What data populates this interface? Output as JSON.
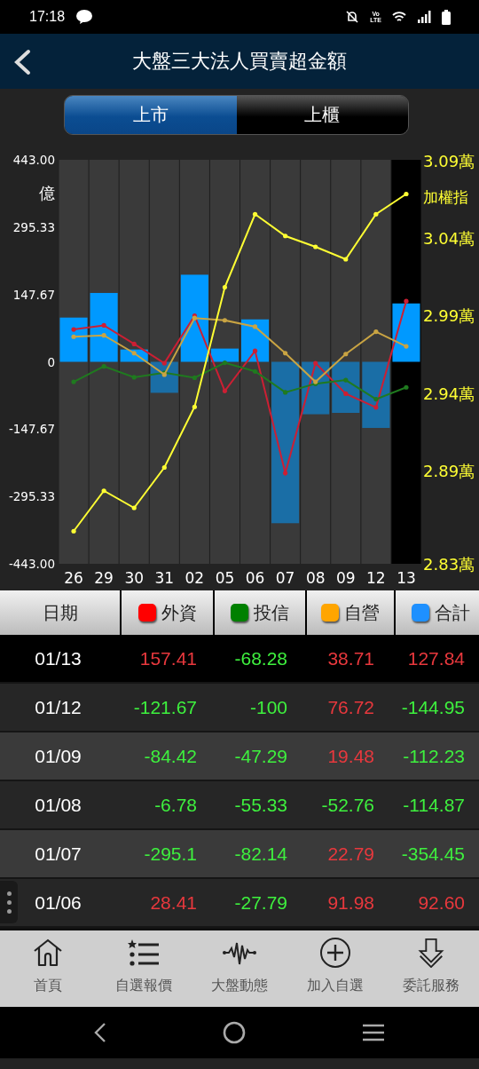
{
  "status_bar": {
    "time": "17:18",
    "network_label": [
      "Vo",
      "LTE"
    ]
  },
  "header": {
    "title": "大盤三大法人買賣超金額"
  },
  "tabs": [
    {
      "label": "上市",
      "selected": true
    },
    {
      "label": "上櫃",
      "selected": false
    }
  ],
  "chart": {
    "chart_data": {
      "type": "bar",
      "ylabel": "億",
      "categories": [
        "26",
        "29",
        "30",
        "31",
        "02",
        "05",
        "06",
        "07",
        "08",
        "09",
        "12",
        "13"
      ],
      "bands": [
        {
          "axis": "x",
          "from": "13",
          "to": "13",
          "color": "#000000"
        }
      ],
      "ylim": [
        -443,
        443
      ],
      "yticks": [
        {
          "value": 443,
          "label": "443.00"
        },
        {
          "value": 295.33,
          "label": "295.33"
        },
        {
          "value": 147.67,
          "label": "147.67"
        },
        {
          "value": 0,
          "label": "0"
        },
        {
          "value": -147.67,
          "label": "-147.67"
        },
        {
          "value": -295.33,
          "label": "-295.33"
        },
        {
          "value": -443,
          "label": "-443.00"
        }
      ],
      "y2lim": [
        2.83,
        3.09
      ],
      "y2ticks": [
        {
          "value": 3.09,
          "label": "3.09萬"
        },
        {
          "value": 3.04,
          "label": "3.04萬"
        },
        {
          "value": 2.99,
          "label": "2.99萬"
        },
        {
          "value": 2.94,
          "label": "2.94萬"
        },
        {
          "value": 2.89,
          "label": "2.89萬"
        },
        {
          "value": 2.83,
          "label": "2.83萬"
        }
      ],
      "series": [
        {
          "color": "#0099ff",
          "values": [
            97,
            151,
            27,
            -68,
            191,
            29,
            93,
            -354,
            -115,
            -112,
            -145,
            128
          ]
        },
        {
          "type": "line",
          "color": "#cc1f33",
          "values": [
            71,
            80,
            39,
            -3,
            101,
            -64,
            24,
            -244,
            -3,
            -70,
            -100,
            133
          ]
        },
        {
          "type": "line",
          "color": "#1f7a1f",
          "values": [
            -44,
            -10,
            -34,
            -24,
            -35,
            -2,
            -21,
            -67,
            -48,
            -40,
            -82,
            -56
          ]
        },
        {
          "type": "line",
          "color": "#c9a443",
          "values": [
            55,
            58,
            19,
            -28,
            96,
            91,
            77,
            19,
            -44,
            17,
            66,
            34
          ]
        },
        {
          "name": "加權指",
          "type": "line",
          "axis": "y2",
          "color": "#ffff33",
          "values": [
            2.851,
            2.877,
            2.866,
            2.892,
            2.931,
            3.008,
            3.055,
            3.041,
            3.034,
            3.026,
            3.055,
            3.068
          ]
        }
      ]
    }
  },
  "table": {
    "columns": [
      {
        "label": "日期"
      },
      {
        "label": "外資",
        "color": "#ff0000"
      },
      {
        "label": "投信",
        "color": "#008000"
      },
      {
        "label": "自營",
        "color": "#ffa500"
      },
      {
        "label": "合計",
        "color": "#1e90ff"
      }
    ],
    "rows": [
      {
        "selected": true,
        "cells": [
          {
            "text": "01/13"
          },
          {
            "text": "157.41",
            "rising": true
          },
          {
            "text": "-68.28",
            "rising": false
          },
          {
            "text": "38.71",
            "rising": true
          },
          {
            "text": "127.84",
            "rising": true
          }
        ]
      },
      {
        "selected": false,
        "cells": [
          {
            "text": "01/12"
          },
          {
            "text": "-121.67",
            "rising": false
          },
          {
            "text": "-100",
            "rising": false
          },
          {
            "text": "76.72",
            "rising": true
          },
          {
            "text": "-144.95",
            "rising": false
          }
        ]
      },
      {
        "selected": false,
        "cells": [
          {
            "text": "01/09"
          },
          {
            "text": "-84.42",
            "rising": false
          },
          {
            "text": "-47.29",
            "rising": false
          },
          {
            "text": "19.48",
            "rising": true
          },
          {
            "text": "-112.23",
            "rising": false
          }
        ]
      },
      {
        "selected": false,
        "cells": [
          {
            "text": "01/08"
          },
          {
            "text": "-6.78",
            "rising": false
          },
          {
            "text": "-55.33",
            "rising": false
          },
          {
            "text": "-52.76",
            "rising": false
          },
          {
            "text": "-114.87",
            "rising": false
          }
        ]
      },
      {
        "selected": false,
        "cells": [
          {
            "text": "01/07"
          },
          {
            "text": "-295.1",
            "rising": false
          },
          {
            "text": "-82.14",
            "rising": false
          },
          {
            "text": "22.79",
            "rising": true
          },
          {
            "text": "-354.45",
            "rising": false
          }
        ]
      },
      {
        "selected": false,
        "cells": [
          {
            "text": "01/06"
          },
          {
            "text": "28.41",
            "rising": true
          },
          {
            "text": "-27.79",
            "rising": false
          },
          {
            "text": "91.98",
            "rising": true
          },
          {
            "text": "92.60",
            "rising": true
          }
        ]
      }
    ]
  },
  "bottom_nav": [
    {
      "label": "首頁"
    },
    {
      "label": "自選報價"
    },
    {
      "label": "大盤動態"
    },
    {
      "label": "加入自選"
    },
    {
      "label": "委託服務"
    }
  ]
}
